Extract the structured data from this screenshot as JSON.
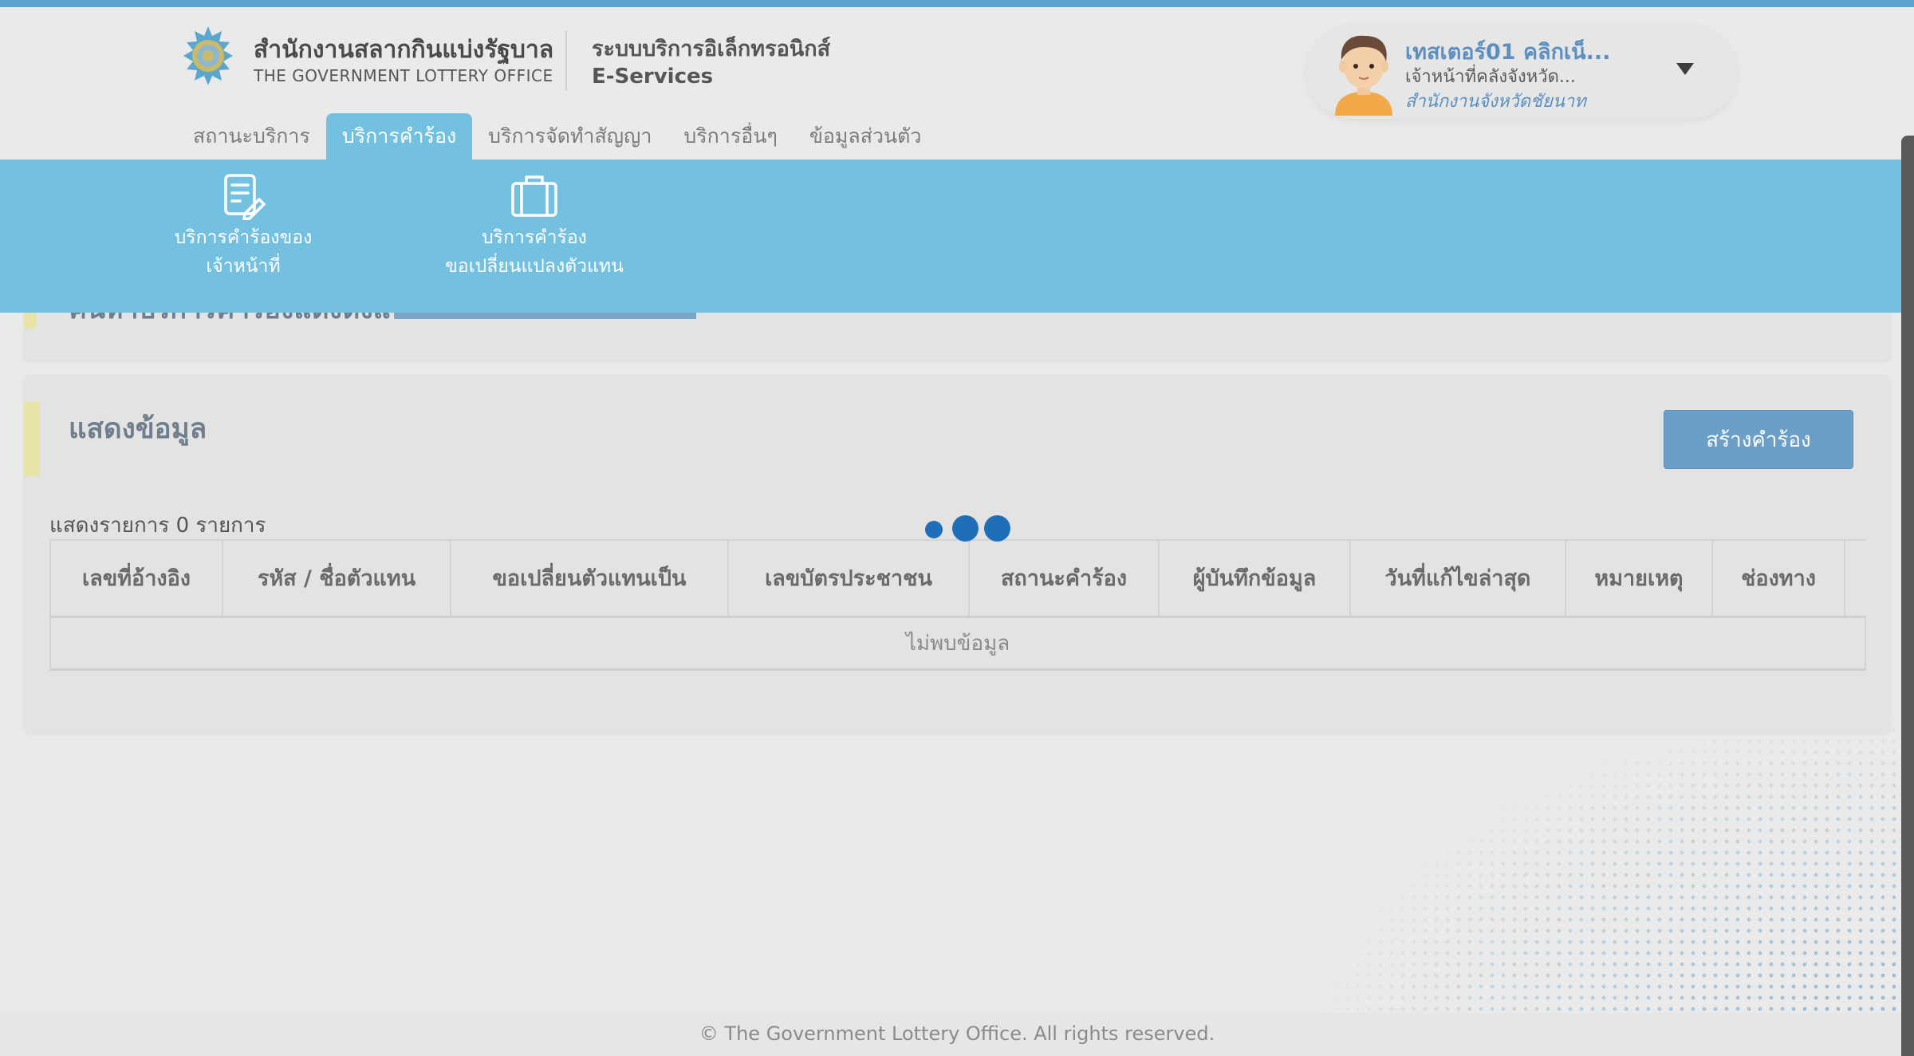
{
  "header": {
    "org_name_th": "สำนักงานสลากกินแบ่งรัฐบาล",
    "org_name_en": "THE GOVERNMENT LOTTERY OFFICE",
    "system_name_th": "ระบบบริการอิเล็กทรอนิกส์",
    "system_name_en": "E-Services"
  },
  "user": {
    "name": "เทสเตอร์01 คลิกเน็...",
    "role": "เจ้าหน้าที่คลังจังหวัด...",
    "office": "สำนักงานจังหวัดชัยนาท"
  },
  "nav": {
    "tabs": [
      {
        "label": "สถานะบริการ",
        "active": false
      },
      {
        "label": "บริการคำร้อง",
        "active": true
      },
      {
        "label": "บริการจัดทำสัญญา",
        "active": false
      },
      {
        "label": "บริการอื่นๆ",
        "active": false
      },
      {
        "label": "ข้อมูลส่วนตัว",
        "active": false
      }
    ]
  },
  "submenu": {
    "items": [
      {
        "line1": "บริการคำร้องของ",
        "line2": "เจ้าหน้าที่",
        "icon": "document-edit-icon"
      },
      {
        "line1": "บริการคำร้อง",
        "line2": "ขอเปลี่ยนแปลงตัวแทน",
        "icon": "briefcase-icon"
      }
    ]
  },
  "search_card": {
    "title": "ค้นหาบริการคำร้องแต่งตั้งแทน"
  },
  "results": {
    "title": "แสดงข้อมูล",
    "create_button": "สร้างคำร้อง",
    "count_text": "แสดงรายการ 0 รายการ",
    "columns": [
      "เลขที่อ้างอิง",
      "รหัส / ชื่อตัวแทน",
      "ขอเปลี่ยนตัวแทนเป็น",
      "เลขบัตรประชาชน",
      "สถานะคำร้อง",
      "ผู้บันทึกข้อมูล",
      "วันที่แก้ไขล่าสุด",
      "หมายเหตุ",
      "ช่องทาง"
    ],
    "empty_text": "ไม่พบข้อมูล"
  },
  "footer": {
    "copyright": "© The Government Lottery Office. All rights reserved."
  },
  "colors": {
    "accent": "#74c0e0",
    "brand_blue": "#5aa6cf",
    "button": "#6b9fc8",
    "loader": "#1f6fb8",
    "section_accent": "#e8e3a6"
  }
}
